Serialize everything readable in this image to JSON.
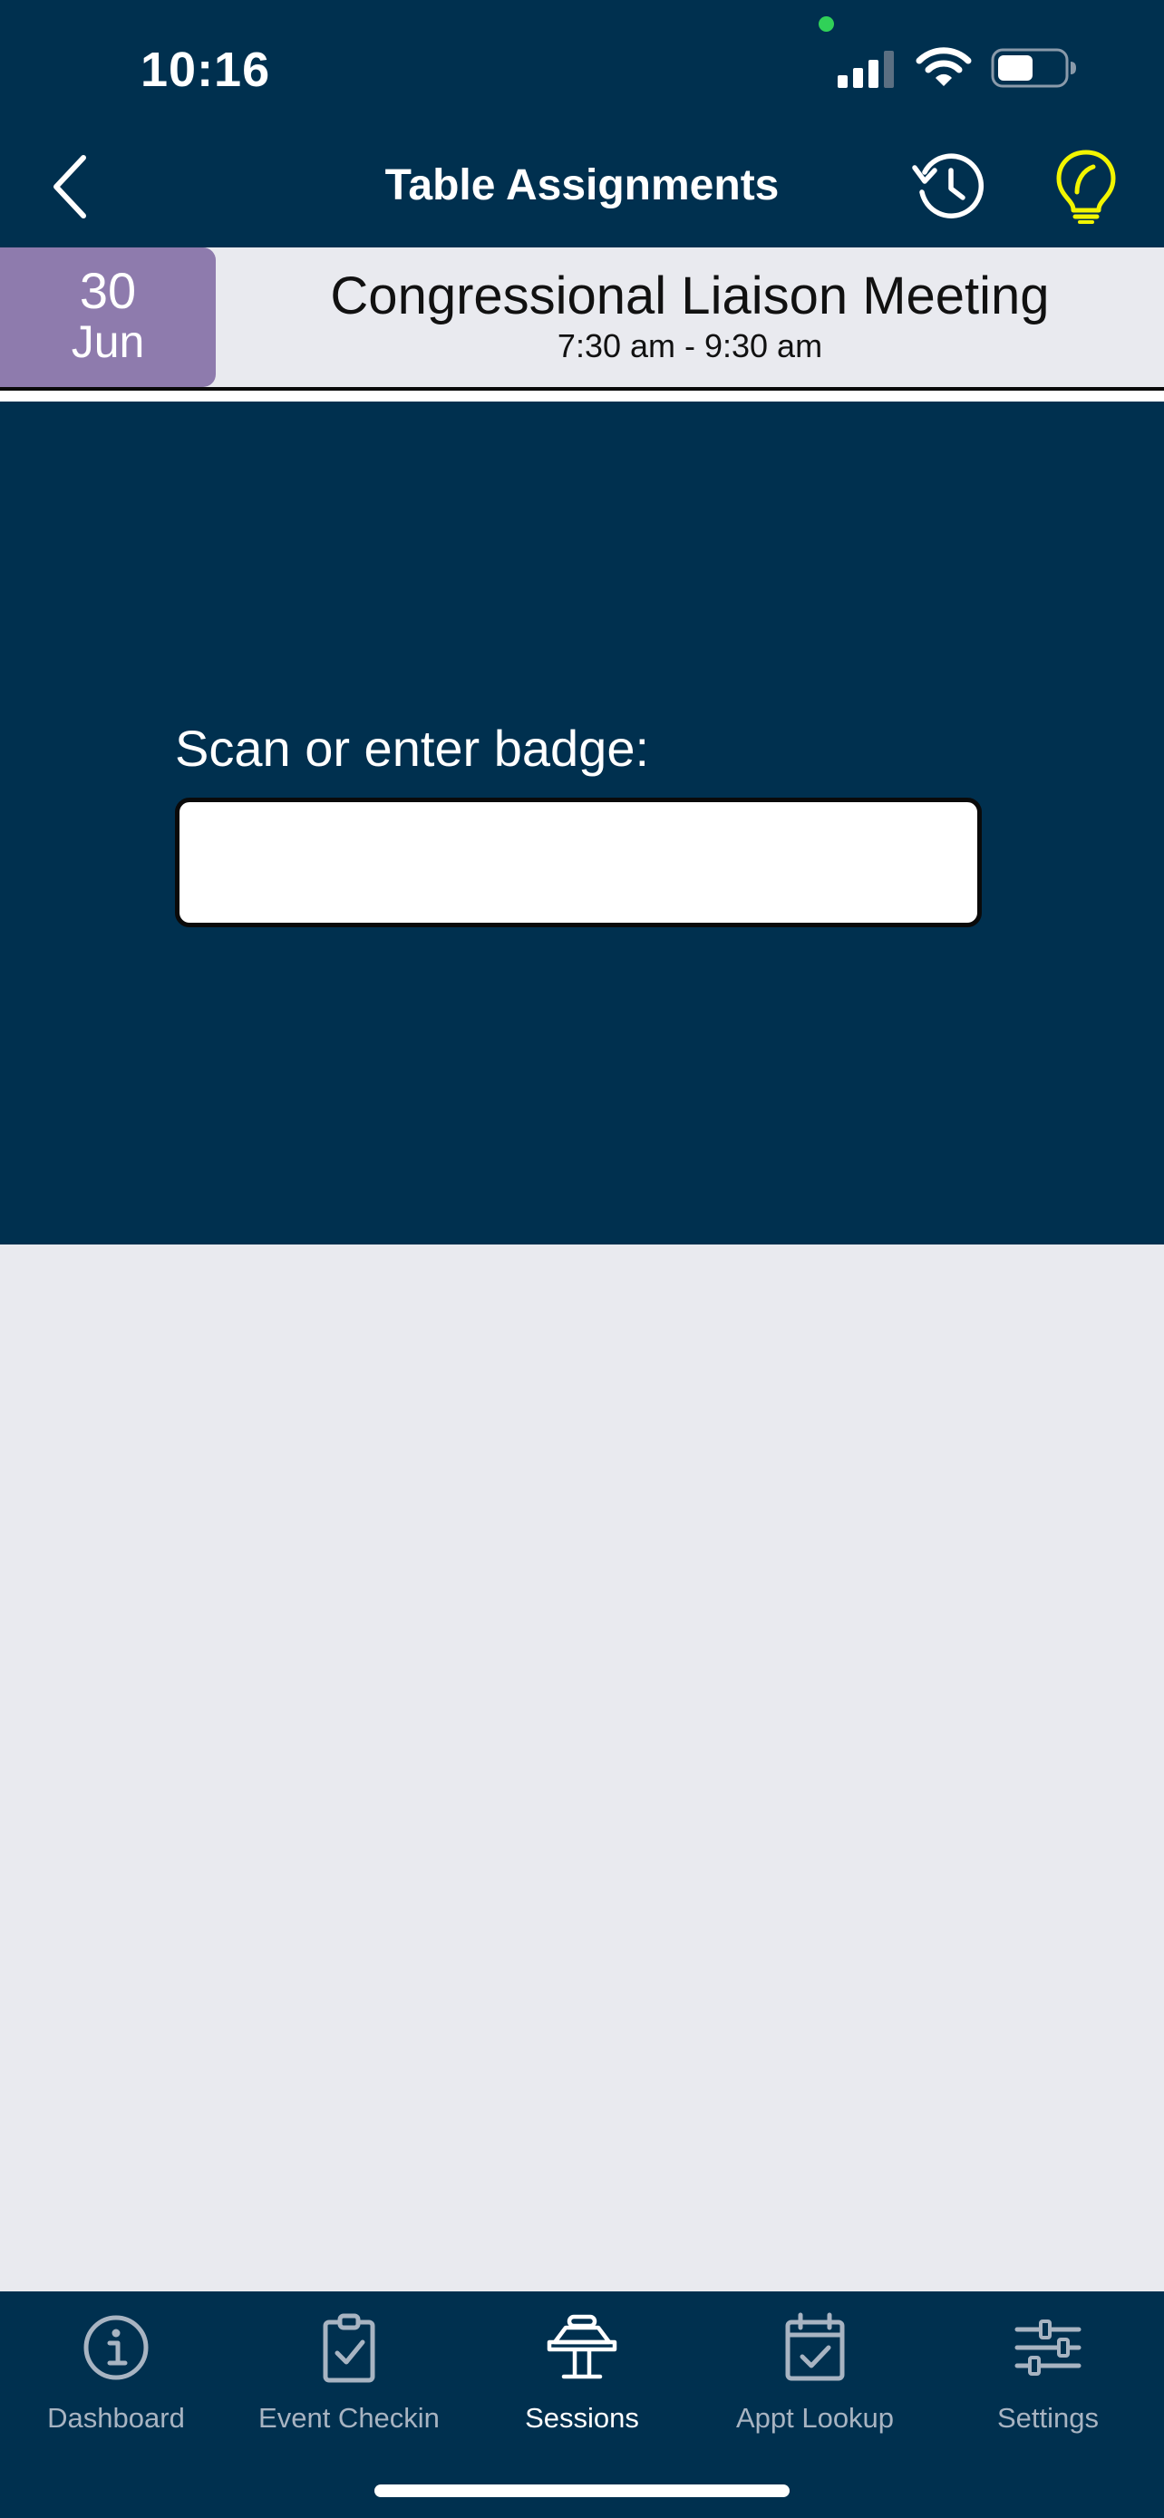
{
  "status_bar": {
    "time": "10:16"
  },
  "nav": {
    "title": "Table Assignments",
    "back_icon": "chevron-left-icon",
    "history_icon": "history-icon",
    "tip_icon": "lightbulb-icon",
    "tip_icon_color": "#F2F500"
  },
  "event": {
    "date_day": "30",
    "date_month": "Jun",
    "title": "Congressional Liaison Meeting",
    "time": "7:30 am - 9:30 am",
    "date_color": "#8E7BAD"
  },
  "scan": {
    "label": "Scan or enter badge:",
    "value": "",
    "placeholder": ""
  },
  "tabs": [
    {
      "label": "Dashboard",
      "icon": "info-circle-icon",
      "active": false
    },
    {
      "label": "Event Checkin",
      "icon": "clipboard-check-icon",
      "active": false
    },
    {
      "label": "Sessions",
      "icon": "podium-icon",
      "active": true
    },
    {
      "label": "Appt Lookup",
      "icon": "calendar-check-icon",
      "active": false
    },
    {
      "label": "Settings",
      "icon": "sliders-icon",
      "active": false
    }
  ],
  "colors": {
    "navy": "#00304F",
    "background": "#E9EAEF"
  }
}
